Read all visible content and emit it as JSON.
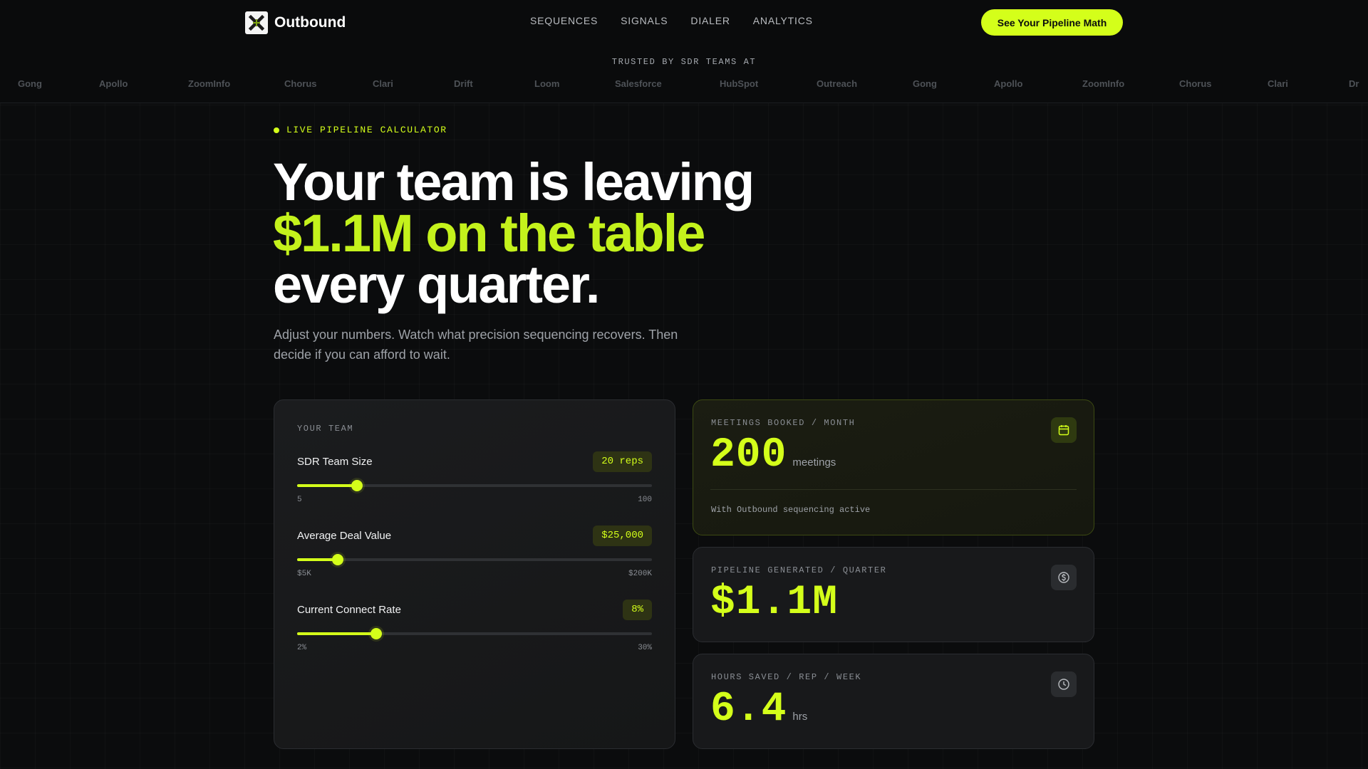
{
  "nav": {
    "brand": "Outbound",
    "links": [
      "SEQUENCES",
      "SIGNALS",
      "DIALER",
      "ANALYTICS"
    ],
    "cta": "See Your Pipeline Math"
  },
  "trusted": {
    "label": "TRUSTED BY SDR TEAMS AT",
    "logos": [
      "Gong",
      "Apollo",
      "ZoomInfo",
      "Chorus",
      "Clari",
      "Drift",
      "Loom",
      "Salesforce",
      "HubSpot",
      "Outreach",
      "Gong",
      "Apollo",
      "ZoomInfo",
      "Chorus",
      "Clari",
      "Dr"
    ]
  },
  "hero": {
    "eyebrow": "LIVE PIPELINE CALCULATOR",
    "headline_line1": "Your team is leaving",
    "headline_line2": "$1.1M on the table",
    "headline_line3": "every quarter.",
    "subhead": "Adjust your numbers. Watch what precision sequencing recovers. Then decide if you can afford to wait."
  },
  "team": {
    "title": "YOUR TEAM",
    "sliders": [
      {
        "label": "SDR Team Size",
        "value": "20 reps",
        "min": "5",
        "max": "100",
        "fraction": 0.168
      },
      {
        "label": "Average Deal Value",
        "value": "$25,000",
        "min": "$5K",
        "max": "$200K",
        "fraction": 0.114
      },
      {
        "label": "Current Connect Rate",
        "value": "8%",
        "min": "2%",
        "max": "30%",
        "fraction": 0.222
      }
    ]
  },
  "metrics": {
    "meetings": {
      "label": "MEETINGS BOOKED / MONTH",
      "value": "200",
      "unit": "meetings",
      "note": "With Outbound sequencing active",
      "icon": "calendar-icon"
    },
    "pipeline": {
      "label": "PIPELINE GENERATED / QUARTER",
      "value": "$1.1M",
      "icon": "dollar-circle-icon"
    },
    "hours": {
      "label": "HOURS SAVED / REP / WEEK",
      "value": "6.4",
      "unit": "hrs",
      "icon": "clock-icon"
    }
  },
  "colors": {
    "accent": "#d4ff1a",
    "background": "#0b0c0d",
    "panel": "#18191b"
  }
}
